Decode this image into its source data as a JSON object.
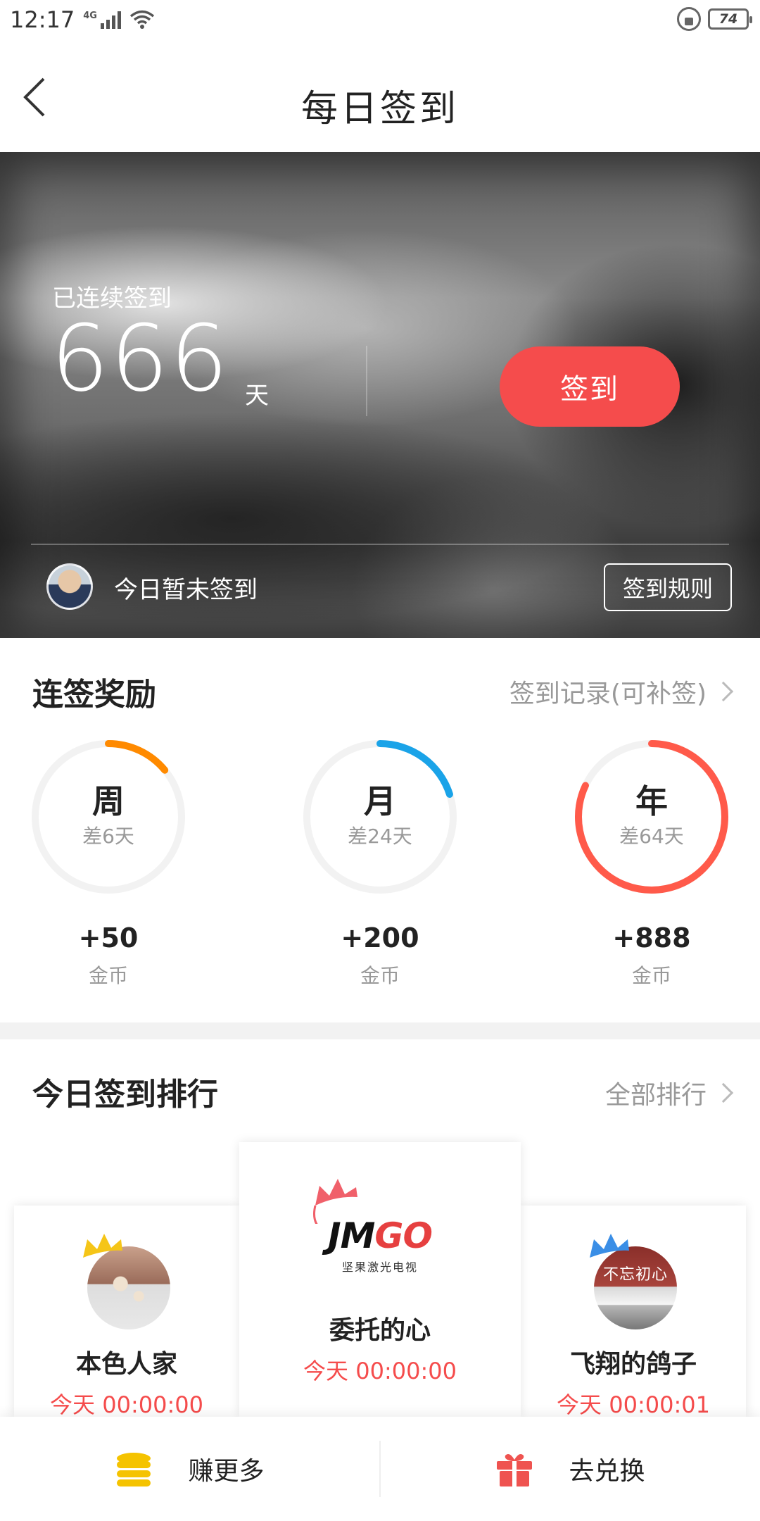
{
  "status_bar": {
    "time": "12:17",
    "network": "4G",
    "battery": "74"
  },
  "header": {
    "title": "每日签到"
  },
  "banner": {
    "streak_label": "已连续签到",
    "streak_days": "666",
    "streak_unit": "天",
    "checkin_label": "签到",
    "status_text": "今日暂未签到",
    "rules_label": "签到规则"
  },
  "rewards": {
    "title": "连签奖励",
    "records_link": "签到记录(可补签)",
    "items": [
      {
        "period": "周",
        "remaining": "差6天",
        "amount": "+50",
        "unit": "金币",
        "color": "#ff8a00",
        "progress": 0.14
      },
      {
        "period": "月",
        "remaining": "差24天",
        "amount": "+200",
        "unit": "金币",
        "color": "#1aa3e8",
        "progress": 0.2
      },
      {
        "period": "年",
        "remaining": "差64天",
        "amount": "+888",
        "unit": "金币",
        "color": "#ff5a4a",
        "progress": 0.82
      }
    ]
  },
  "ranking": {
    "title": "今日签到排行",
    "all_link": "全部排行",
    "entries": [
      {
        "name": "本色人家",
        "time": "今天 00:00:00",
        "crown_color": "#f5c518"
      },
      {
        "name": "委托的心",
        "time": "今天 00:00:00",
        "crown_color": "#f0606a",
        "logo_text": "JMGO",
        "logo_sub": "坚果激光电视"
      },
      {
        "name": "飞翔的鸽子",
        "time": "今天 00:00:01",
        "crown_color": "#3a8ee6",
        "avatar_text": "不忘初心"
      }
    ]
  },
  "bottom": {
    "earn_label": "赚更多",
    "exchange_label": "去兑换"
  }
}
